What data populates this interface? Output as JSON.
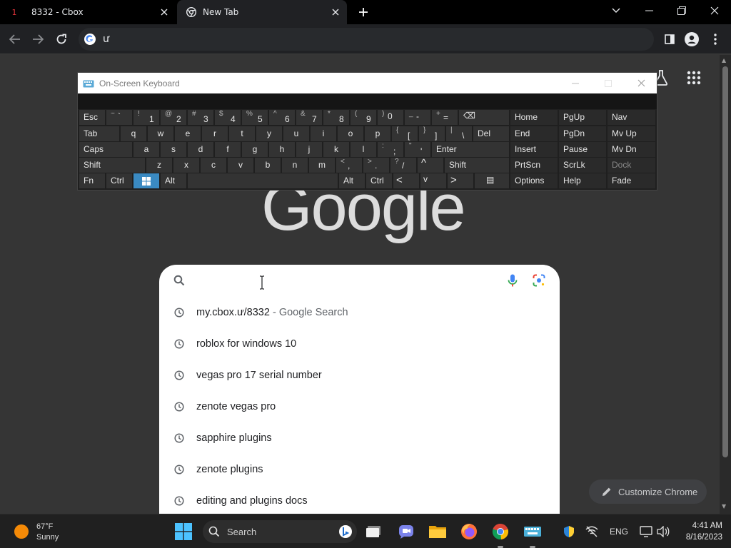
{
  "tabs": [
    {
      "badge": "1",
      "title": "8332 - Cbox",
      "favicon": "cbox-icon"
    },
    {
      "title": "New Tab",
      "favicon": "chrome-icon"
    }
  ],
  "omnibox": {
    "value": "ư"
  },
  "keyboard": {
    "title": "On-Screen Keyboard",
    "rows": [
      [
        [
          "Esc"
        ],
        [
          "~",
          "`"
        ],
        [
          "!",
          "1"
        ],
        [
          "@",
          "2"
        ],
        [
          "#",
          "3"
        ],
        [
          "$",
          "4"
        ],
        [
          "%",
          "5"
        ],
        [
          "^",
          "6"
        ],
        [
          "&",
          "7"
        ],
        [
          "*",
          "8"
        ],
        [
          "(",
          "9"
        ],
        [
          ")",
          "0"
        ],
        [
          "_",
          "-"
        ],
        [
          "+",
          "="
        ],
        [
          "⌫"
        ]
      ],
      [
        [
          "Tab"
        ],
        [
          "q"
        ],
        [
          "w"
        ],
        [
          "e"
        ],
        [
          "r"
        ],
        [
          "t"
        ],
        [
          "y"
        ],
        [
          "u"
        ],
        [
          "i"
        ],
        [
          "o"
        ],
        [
          "p"
        ],
        [
          "{",
          "["
        ],
        [
          "}",
          "]"
        ],
        [
          "|",
          "\\"
        ],
        [
          "Del"
        ]
      ],
      [
        [
          "Caps"
        ],
        [
          "a"
        ],
        [
          "s"
        ],
        [
          "d"
        ],
        [
          "f"
        ],
        [
          "g"
        ],
        [
          "h"
        ],
        [
          "j"
        ],
        [
          "k"
        ],
        [
          "l"
        ],
        [
          ":",
          ";"
        ],
        [
          "\"",
          "'"
        ],
        [
          "Enter"
        ]
      ],
      [
        [
          "Shift"
        ],
        [
          "z"
        ],
        [
          "x"
        ],
        [
          "c"
        ],
        [
          "v"
        ],
        [
          "b"
        ],
        [
          "n"
        ],
        [
          "m"
        ],
        [
          "<",
          ","
        ],
        [
          ">",
          "."
        ],
        [
          "?",
          "/"
        ],
        [
          "^"
        ],
        [
          "Shift"
        ]
      ],
      [
        [
          "Fn"
        ],
        [
          "Ctrl"
        ],
        [
          "⊞"
        ],
        [
          "Alt"
        ],
        [
          ""
        ],
        [
          "Alt"
        ],
        [
          "Ctrl"
        ],
        [
          "<"
        ],
        [
          "v"
        ],
        [
          ">"
        ],
        [
          "▤"
        ]
      ]
    ],
    "nav_keys": [
      [
        "Home",
        "PgUp",
        "Nav"
      ],
      [
        "End",
        "PgDn",
        "Mv Up"
      ],
      [
        "Insert",
        "Pause",
        "Mv Dn"
      ],
      [
        "PrtScn",
        "ScrLk",
        "Dock"
      ],
      [
        "Options",
        "Help",
        "Fade"
      ]
    ]
  },
  "logo": "Google",
  "search": {
    "value": "",
    "suggestions": [
      {
        "text": "my.cbox.ư/8332",
        "sub": " - Google Search"
      },
      {
        "text": "roblox for windows 10",
        "sub": ""
      },
      {
        "text": "vegas pro 17 serial number",
        "sub": ""
      },
      {
        "text": "zenote vegas pro",
        "sub": ""
      },
      {
        "text": "sapphire plugins",
        "sub": ""
      },
      {
        "text": "zenote plugins",
        "sub": ""
      },
      {
        "text": "editing and plugins docs",
        "sub": ""
      }
    ]
  },
  "customize_label": "Customize Chrome",
  "taskbar": {
    "weather_temp": "67°F",
    "weather_desc": "Sunny",
    "search_label": "Search",
    "lang": "ENG",
    "time": "4:41 AM",
    "date": "8/16/2023"
  }
}
